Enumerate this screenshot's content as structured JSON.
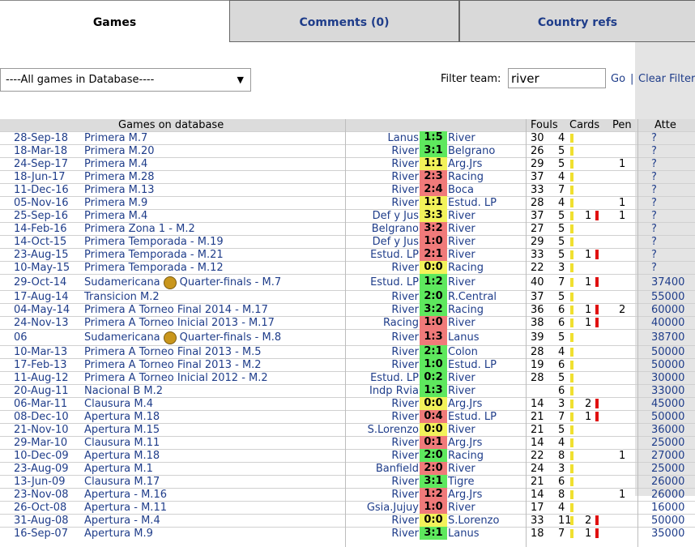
{
  "tabs": [
    {
      "label": "Games",
      "active": true
    },
    {
      "label": "Comments (0)",
      "active": false
    },
    {
      "label": "Country refs",
      "active": false
    }
  ],
  "filter": {
    "select_value": "----All games in Database----",
    "label": "Filter team:",
    "value": "river",
    "go": "Go",
    "separator": "|",
    "clear": "Clear Filter"
  },
  "table": {
    "headers": {
      "games": "Games on database",
      "fouls": "Fouls",
      "cards": "Cards",
      "pen": "Pen",
      "att": "Atte"
    },
    "colors": {
      "win": "#5ee85e",
      "draw": "#f2f25a",
      "loss": "#f07a7a",
      "yellow_card": "#f0e030",
      "red_card": "#e01010"
    },
    "rows": [
      {
        "date": "28-Sep-18",
        "comp": "Primera M.7",
        "home": "Lanus",
        "score": "1:5",
        "away": "River",
        "result": "win",
        "fouls": "30",
        "yellow": "4",
        "red": "",
        "pen": "",
        "att": "?"
      },
      {
        "date": "18-Mar-18",
        "comp": "Primera M.20",
        "home": "River",
        "score": "3:1",
        "away": "Belgrano",
        "result": "win",
        "fouls": "26",
        "yellow": "5",
        "red": "",
        "pen": "",
        "att": "?"
      },
      {
        "date": "24-Sep-17",
        "comp": "Primera M.4",
        "home": "River",
        "score": "1:1",
        "away": "Arg.Jrs",
        "result": "draw",
        "fouls": "29",
        "yellow": "5",
        "red": "",
        "pen": "1",
        "att": "?"
      },
      {
        "date": "18-Jun-17",
        "comp": "Primera M.28",
        "home": "River",
        "score": "2:3",
        "away": "Racing",
        "result": "loss",
        "fouls": "37",
        "yellow": "4",
        "red": "",
        "pen": "",
        "att": "?"
      },
      {
        "date": "11-Dec-16",
        "comp": "Primera M.13",
        "home": "River",
        "score": "2:4",
        "away": "Boca",
        "result": "loss",
        "fouls": "33",
        "yellow": "7",
        "red": "",
        "pen": "",
        "att": "?"
      },
      {
        "date": "05-Nov-16",
        "comp": "Primera M.9",
        "home": "River",
        "score": "1:1",
        "away": "Estud. LP",
        "result": "draw",
        "fouls": "28",
        "yellow": "4",
        "red": "",
        "pen": "1",
        "att": "?"
      },
      {
        "date": "25-Sep-16",
        "comp": "Primera M.4",
        "home": "Def y Jus",
        "score": "3:3",
        "away": "River",
        "result": "draw",
        "fouls": "37",
        "yellow": "5",
        "red": "1",
        "pen": "1",
        "att": "?"
      },
      {
        "date": "14-Feb-16",
        "comp": "Primera Zona 1 - M.2",
        "home": "Belgrano",
        "score": "3:2",
        "away": "River",
        "result": "loss",
        "fouls": "27",
        "yellow": "5",
        "red": "",
        "pen": "",
        "att": "?"
      },
      {
        "date": "14-Oct-15",
        "comp": "Primera Temporada - M.19",
        "home": "Def y Jus",
        "score": "1:0",
        "away": "River",
        "result": "loss",
        "fouls": "29",
        "yellow": "5",
        "red": "",
        "pen": "",
        "att": "?"
      },
      {
        "date": "23-Aug-15",
        "comp": "Primera Temporada - M.21",
        "home": "Estud. LP",
        "score": "2:1",
        "away": "River",
        "result": "loss",
        "fouls": "33",
        "yellow": "5",
        "red": "1",
        "pen": "",
        "att": "?"
      },
      {
        "date": "10-May-15",
        "comp": "Primera Temporada - M.12",
        "home": "River",
        "score": "0:0",
        "away": "Racing",
        "result": "draw",
        "fouls": "22",
        "yellow": "3",
        "red": "",
        "pen": "",
        "att": "?"
      },
      {
        "date": "29-Oct-14",
        "comp": "Sudamericana",
        "comp2": "Quarter-finals - M.7",
        "icon": "cup",
        "home": "Estud. LP",
        "score": "1:2",
        "away": "River",
        "result": "win",
        "fouls": "40",
        "yellow": "7",
        "red": "1",
        "pen": "",
        "att": "37400"
      },
      {
        "date": "17-Aug-14",
        "comp": "Transicion M.2",
        "home": "River",
        "score": "2:0",
        "away": "R.Central",
        "result": "win",
        "fouls": "37",
        "yellow": "5",
        "red": "",
        "pen": "",
        "att": "55000"
      },
      {
        "date": "04-May-14",
        "comp": "Primera A Torneo Final 2014 - M.17",
        "home": "River",
        "score": "3:2",
        "away": "Racing",
        "result": "win",
        "fouls": "36",
        "yellow": "6",
        "red": "1",
        "pen": "2",
        "att": "60000"
      },
      {
        "date": "24-Nov-13",
        "comp": "Primera A Torneo Inicial 2013 - M.17",
        "home": "Racing",
        "score": "1:0",
        "away": "River",
        "result": "loss",
        "fouls": "38",
        "yellow": "6",
        "red": "1",
        "pen": "",
        "att": "40000"
      },
      {
        "date": "06",
        "comp": "Sudamericana",
        "comp2": "Quarter-finals - M.8",
        "icon": "cup",
        "home": "River",
        "score": "1:3",
        "away": "Lanus",
        "result": "loss",
        "fouls": "39",
        "yellow": "5",
        "red": "",
        "pen": "",
        "att": "38700"
      },
      {
        "date": "10-Mar-13",
        "comp": "Primera A Torneo Final 2013 - M.5",
        "home": "River",
        "score": "2:1",
        "away": "Colon",
        "result": "win",
        "fouls": "28",
        "yellow": "4",
        "red": "",
        "pen": "",
        "att": "50000"
      },
      {
        "date": "17-Feb-13",
        "comp": "Primera A Torneo Final 2013 - M.2",
        "home": "River",
        "score": "1:0",
        "away": "Estud. LP",
        "result": "win",
        "fouls": "19",
        "yellow": "6",
        "red": "",
        "pen": "",
        "att": "50000"
      },
      {
        "date": "11-Aug-12",
        "comp": "Primera A Torneo Inicial 2012 - M.2",
        "home": "Estud. LP",
        "score": "0:2",
        "away": "River",
        "result": "win",
        "fouls": "28",
        "yellow": "5",
        "red": "",
        "pen": "",
        "att": "30000"
      },
      {
        "date": "20-Aug-11",
        "comp": "Nacional B M.2",
        "home": "Indp Rvia",
        "score": "1:3",
        "away": "River",
        "result": "win",
        "fouls": "",
        "yellow": "6",
        "red": "",
        "pen": "",
        "att": "33000"
      },
      {
        "date": "06-Mar-11",
        "comp": "Clausura M.4",
        "home": "River",
        "score": "0:0",
        "away": "Arg.Jrs",
        "result": "draw",
        "fouls": "14",
        "yellow": "3",
        "red": "2",
        "pen": "",
        "att": "45000"
      },
      {
        "date": "08-Dec-10",
        "comp": "Apertura M.18",
        "home": "River",
        "score": "0:4",
        "away": "Estud. LP",
        "result": "loss",
        "fouls": "21",
        "yellow": "7",
        "red": "1",
        "pen": "",
        "att": "50000"
      },
      {
        "date": "21-Nov-10",
        "comp": "Apertura M.15",
        "home": "S.Lorenzo",
        "score": "0:0",
        "away": "River",
        "result": "draw",
        "fouls": "21",
        "yellow": "5",
        "red": "",
        "pen": "",
        "att": "36000"
      },
      {
        "date": "29-Mar-10",
        "comp": "Clausura M.11",
        "home": "River",
        "score": "0:1",
        "away": "Arg.Jrs",
        "result": "loss",
        "fouls": "14",
        "yellow": "4",
        "red": "",
        "pen": "",
        "att": "25000"
      },
      {
        "date": "10-Dec-09",
        "comp": "Apertura M.18",
        "home": "River",
        "score": "2:0",
        "away": "Racing",
        "result": "win",
        "fouls": "22",
        "yellow": "8",
        "red": "",
        "pen": "1",
        "att": "27000"
      },
      {
        "date": "23-Aug-09",
        "comp": "Apertura M.1",
        "home": "Banfield",
        "score": "2:0",
        "away": "River",
        "result": "loss",
        "fouls": "24",
        "yellow": "3",
        "red": "",
        "pen": "",
        "att": "25000"
      },
      {
        "date": "13-Jun-09",
        "comp": "Clausura M.17",
        "home": "River",
        "score": "3:1",
        "away": "Tigre",
        "result": "win",
        "fouls": "21",
        "yellow": "6",
        "red": "",
        "pen": "",
        "att": "26000"
      },
      {
        "date": "23-Nov-08",
        "comp": "Apertura - M.16",
        "home": "River",
        "score": "1:2",
        "away": "Arg.Jrs",
        "result": "loss",
        "fouls": "14",
        "yellow": "8",
        "red": "",
        "pen": "1",
        "att": "26000"
      },
      {
        "date": "26-Oct-08",
        "comp": "Apertura - M.11",
        "home": "Gsia.Jujuy",
        "score": "1:0",
        "away": "River",
        "result": "loss",
        "fouls": "17",
        "yellow": "4",
        "red": "",
        "pen": "",
        "att": "16000"
      },
      {
        "date": "31-Aug-08",
        "comp": "Apertura - M.4",
        "home": "River",
        "score": "0:0",
        "away": "S.Lorenzo",
        "result": "draw",
        "fouls": "33",
        "yellow": "11",
        "red": "2",
        "pen": "",
        "att": "50000"
      },
      {
        "date": "16-Sep-07",
        "comp": "Apertura M.9",
        "home": "River",
        "score": "3:1",
        "away": "Lanus",
        "result": "win",
        "fouls": "18",
        "yellow": "7",
        "red": "1",
        "pen": "",
        "att": "35000"
      }
    ]
  }
}
